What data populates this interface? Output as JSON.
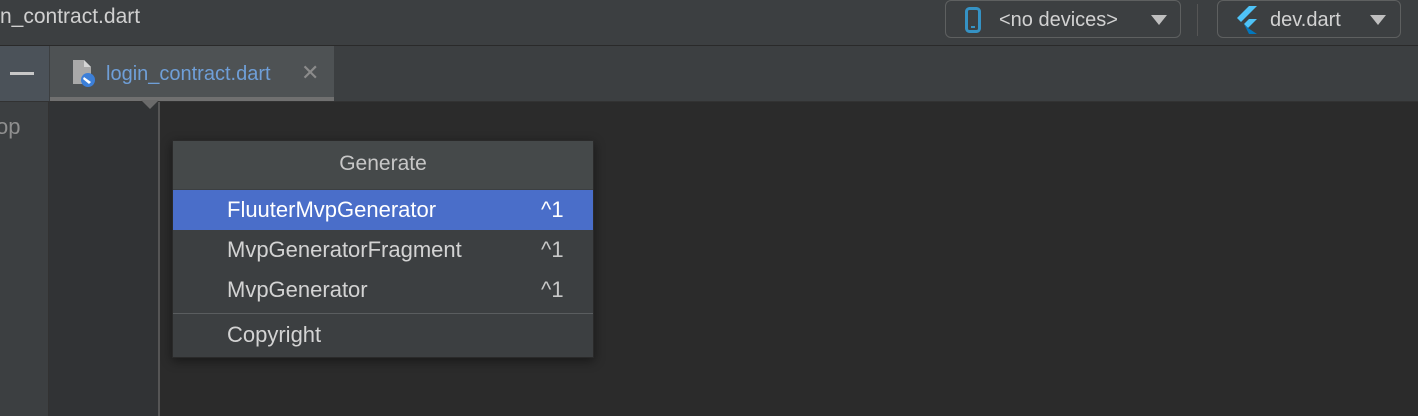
{
  "toolbar": {
    "breadcrumb": "n_contract.dart",
    "device_selector": {
      "label": "<no devices>",
      "icon": "phone-icon"
    },
    "run_config": {
      "label": "dev.dart",
      "icon": "flutter-icon"
    }
  },
  "tabbar": {
    "collapse_icon": "minus-icon",
    "active_tab": {
      "label": "login_contract.dart",
      "close_glyph": "✕",
      "icon": "dart-file-icon"
    }
  },
  "side_panel": {
    "partial_text": "op"
  },
  "generate_popup": {
    "title": "Generate",
    "items": [
      {
        "label": "FluuterMvpGenerator",
        "shortcut": "^1",
        "selected": true
      },
      {
        "label": "MvpGeneratorFragment",
        "shortcut": "^1",
        "selected": false
      },
      {
        "label": "MvpGenerator",
        "shortcut": "^1",
        "selected": false
      },
      {
        "label": "Copyright",
        "shortcut": "",
        "selected": false
      }
    ]
  },
  "colors": {
    "selection": "#4a6ec9",
    "tab_label": "#6f9fd8",
    "editor_bg": "#2b2b2b",
    "toolbar_bg": "#3c3f41"
  }
}
